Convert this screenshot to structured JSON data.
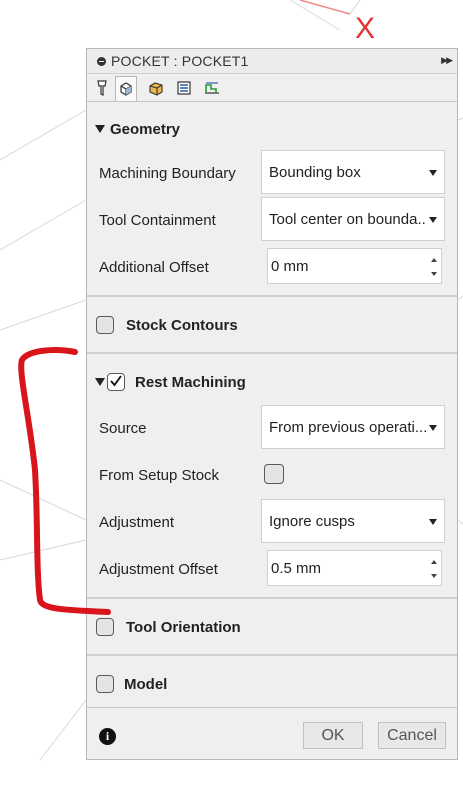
{
  "dialog": {
    "title": "POCKET : POCKET1",
    "tabs": [
      {
        "icon": "tool-icon"
      },
      {
        "icon": "geometry-icon"
      },
      {
        "icon": "heights-icon"
      },
      {
        "icon": "passes-icon"
      },
      {
        "icon": "linking-icon"
      }
    ]
  },
  "geometry": {
    "title": "Geometry",
    "machining_boundary": {
      "label": "Machining Boundary",
      "value": "Bounding box"
    },
    "tool_containment": {
      "label": "Tool Containment",
      "value": "Tool center on bounda..."
    },
    "additional_offset": {
      "label": "Additional Offset",
      "value": "0 mm"
    }
  },
  "stock_contours": {
    "title": "Stock Contours",
    "checked": false
  },
  "rest_machining": {
    "title": "Rest Machining",
    "checked": true,
    "source": {
      "label": "Source",
      "value": "From previous operati..."
    },
    "from_setup_stock": {
      "label": "From Setup Stock",
      "checked": false
    },
    "adjustment": {
      "label": "Adjustment",
      "value": "Ignore cusps"
    },
    "adjustment_offset": {
      "label": "Adjustment Offset",
      "value": "0.5 mm"
    }
  },
  "tool_orientation": {
    "title": "Tool Orientation",
    "checked": false
  },
  "model": {
    "title": "Model",
    "checked": false
  },
  "footer": {
    "ok_label": "OK",
    "cancel_label": "Cancel"
  },
  "viewport": {
    "axis_label": "X"
  },
  "colors": {
    "annotation": "#d9141b",
    "axis": "#e03434"
  }
}
